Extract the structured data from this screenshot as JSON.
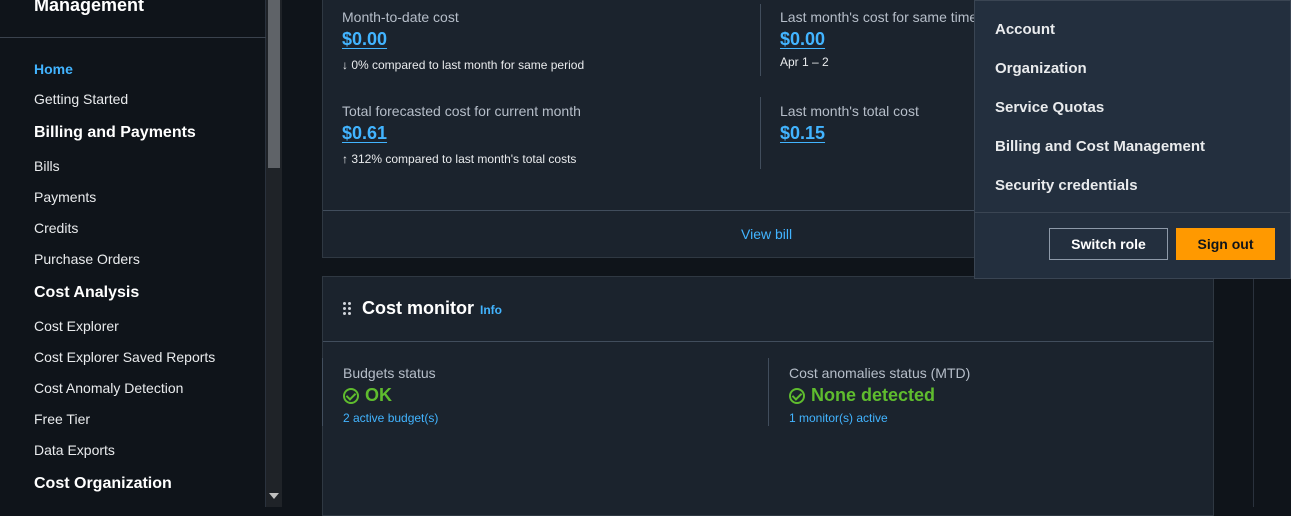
{
  "sidebar": {
    "title": "Management",
    "items": [
      {
        "label": "Home",
        "active": true
      },
      {
        "label": "Getting Started"
      },
      {
        "label": "Billing and Payments",
        "section": true
      },
      {
        "label": "Bills"
      },
      {
        "label": "Payments"
      },
      {
        "label": "Credits"
      },
      {
        "label": "Purchase Orders"
      },
      {
        "label": "Cost Analysis",
        "section": true
      },
      {
        "label": "Cost Explorer"
      },
      {
        "label": "Cost Explorer Saved Reports"
      },
      {
        "label": "Cost Anomaly Detection"
      },
      {
        "label": "Free Tier"
      },
      {
        "label": "Data Exports"
      },
      {
        "label": "Cost Organization",
        "section": true
      }
    ]
  },
  "cost_summary": {
    "mtd_label": "Month-to-date cost",
    "mtd_value": "$0.00",
    "mtd_sub": "↓ 0% compared to last month for same period",
    "last_same_label": "Last month's cost for same time period",
    "last_same_value": "$0.00",
    "last_same_sub": "Apr 1 – 2",
    "forecast_label": "Total forecasted cost for current month",
    "forecast_value": "$0.61",
    "forecast_sub": "↑ 312% compared to last month's total costs",
    "last_total_label": "Last month's total cost",
    "last_total_value": "$0.15",
    "view_bill": "View bill"
  },
  "cost_monitor": {
    "title": "Cost monitor",
    "info": "Info",
    "budgets_label": "Budgets status",
    "budgets_status": "OK",
    "budgets_link": "2 active budget(s)",
    "anomalies_label": "Cost anomalies status (MTD)",
    "anomalies_status": "None detected",
    "anomalies_link": "1 monitor(s) active"
  },
  "account_menu": {
    "items": [
      "Account",
      "Organization",
      "Service Quotas",
      "Billing and Cost Management",
      "Security credentials"
    ],
    "switch_role": "Switch role",
    "sign_out": "Sign out"
  },
  "colors": {
    "accent": "#42b4ff",
    "success": "#5fbc2e",
    "primary_button": "#ff9900"
  }
}
